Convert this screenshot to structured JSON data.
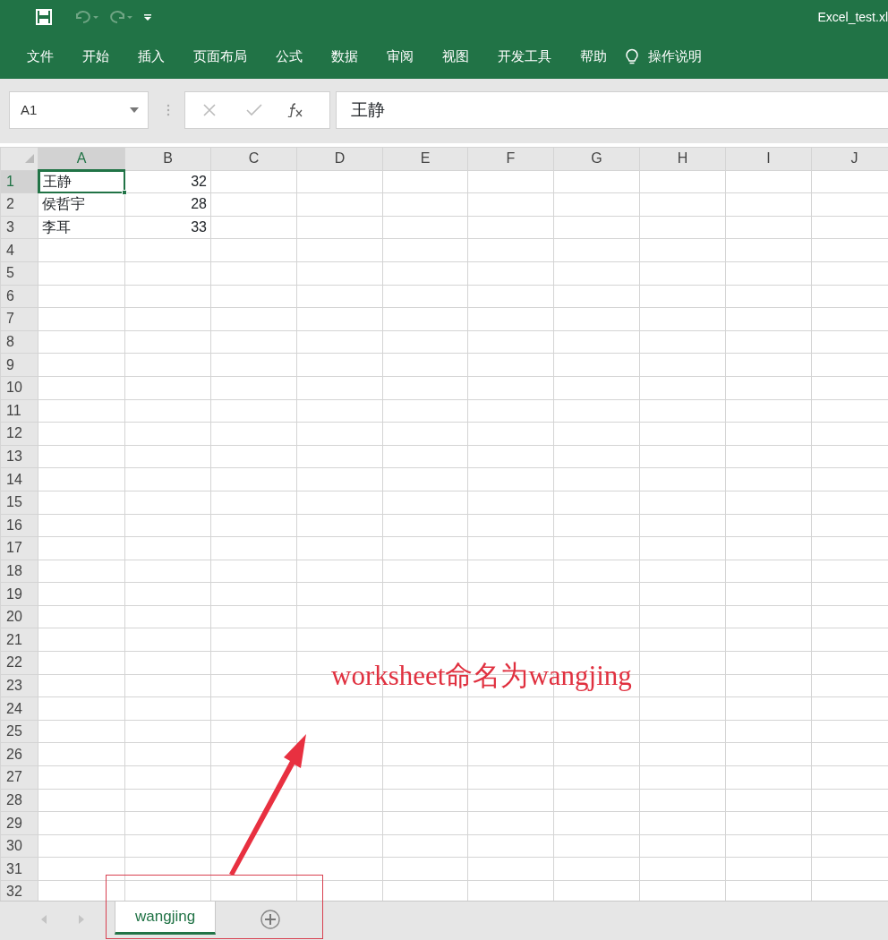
{
  "title_bar": {
    "title": "Excel_test.xl"
  },
  "ribbon_tabs": [
    {
      "label": "文件"
    },
    {
      "label": "开始"
    },
    {
      "label": "插入"
    },
    {
      "label": "页面布局"
    },
    {
      "label": "公式"
    },
    {
      "label": "数据"
    },
    {
      "label": "审阅"
    },
    {
      "label": "视图"
    },
    {
      "label": "开发工具"
    },
    {
      "label": "帮助"
    }
  ],
  "tell_me": "操作说明",
  "name_box": "A1",
  "formula": "王静",
  "columns": [
    {
      "label": "A",
      "selected": true
    },
    {
      "label": "B",
      "selected": false
    },
    {
      "label": "C",
      "selected": false
    },
    {
      "label": "D",
      "selected": false
    },
    {
      "label": "E",
      "selected": false
    },
    {
      "label": "F",
      "selected": false
    },
    {
      "label": "G",
      "selected": false
    },
    {
      "label": "H",
      "selected": false
    },
    {
      "label": "I",
      "selected": false
    },
    {
      "label": "J",
      "selected": false
    }
  ],
  "rows": [
    {
      "number": "1",
      "selected": true,
      "cells": [
        {
          "text": "王静",
          "selected": true
        },
        {
          "text": "32",
          "selected": false
        }
      ]
    },
    {
      "number": "2",
      "selected": false,
      "cells": [
        {
          "text": "侯哲宇",
          "selected": false
        },
        {
          "text": "28",
          "selected": false
        }
      ]
    },
    {
      "number": "3",
      "selected": false,
      "cells": [
        {
          "text": "李耳",
          "selected": false
        },
        {
          "text": "33",
          "selected": false
        }
      ]
    },
    {
      "number": "4"
    },
    {
      "number": "5"
    },
    {
      "number": "6"
    },
    {
      "number": "7"
    },
    {
      "number": "8"
    },
    {
      "number": "9"
    },
    {
      "number": "10"
    },
    {
      "number": "11"
    },
    {
      "number": "12"
    },
    {
      "number": "13"
    },
    {
      "number": "14"
    },
    {
      "number": "15"
    },
    {
      "number": "16"
    },
    {
      "number": "17"
    },
    {
      "number": "18"
    },
    {
      "number": "19"
    },
    {
      "number": "20"
    },
    {
      "number": "21"
    },
    {
      "number": "22"
    },
    {
      "number": "23"
    },
    {
      "number": "24"
    },
    {
      "number": "25"
    },
    {
      "number": "26"
    },
    {
      "number": "27"
    },
    {
      "number": "28"
    },
    {
      "number": "29"
    },
    {
      "number": "30"
    },
    {
      "number": "31"
    },
    {
      "number": "32"
    }
  ],
  "sheet_tabs": [
    {
      "label": "wangjing",
      "selected": true
    }
  ],
  "annotation": {
    "text": "worksheet命名为wangjing"
  }
}
